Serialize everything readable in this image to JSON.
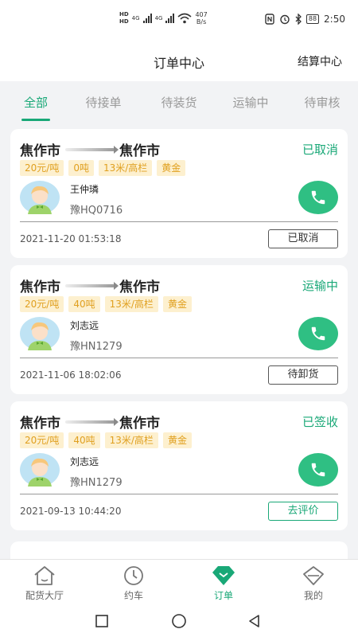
{
  "status_bar": {
    "hd1": "HD",
    "hd2": "HD",
    "net1": "4G",
    "net2": "4G",
    "speed_value": "407",
    "speed_unit": "B/s",
    "battery": "88",
    "time": "2:50"
  },
  "header": {
    "title": "订单中心",
    "right_link": "结算中心"
  },
  "tabs": [
    {
      "label": "全部",
      "active": true
    },
    {
      "label": "待接单",
      "active": false
    },
    {
      "label": "待装货",
      "active": false
    },
    {
      "label": "运输中",
      "active": false
    },
    {
      "label": "待审核",
      "active": false
    }
  ],
  "orders": [
    {
      "origin": "焦作市",
      "destination": "焦作市",
      "status": "已取消",
      "tags": [
        "20元/吨",
        "0吨",
        "13米/高栏",
        "黄金"
      ],
      "driver_name": "王仲璘",
      "plate": "豫HQ0716",
      "date": "2021-11-20 01:53:18",
      "action": "已取消",
      "action_style": "gray"
    },
    {
      "origin": "焦作市",
      "destination": "焦作市",
      "status": "运输中",
      "tags": [
        "20元/吨",
        "40吨",
        "13米/高栏",
        "黄金"
      ],
      "driver_name": "刘志远",
      "plate": "豫HN1279",
      "date": "2021-11-06 18:02:06",
      "action": "待卸货",
      "action_style": "gray"
    },
    {
      "origin": "焦作市",
      "destination": "焦作市",
      "status": "已签收",
      "tags": [
        "20元/吨",
        "40吨",
        "13米/高栏",
        "黄金"
      ],
      "driver_name": "刘志远",
      "plate": "豫HN1279",
      "date": "2021-09-13 10:44:20",
      "action": "去评价",
      "action_style": "green"
    }
  ],
  "bottom_nav": [
    {
      "label": "配货大厅",
      "icon": "home-icon",
      "active": false
    },
    {
      "label": "约车",
      "icon": "clock-icon",
      "active": false
    },
    {
      "label": "订单",
      "icon": "diamond-icon",
      "active": true
    },
    {
      "label": "我的",
      "icon": "profile-diamond-icon",
      "active": false
    }
  ],
  "colors": {
    "accent": "#19a877",
    "tag_bg": "#fdf0cf",
    "tag_text": "#e0a020",
    "phone_bg": "#2fbf83"
  }
}
